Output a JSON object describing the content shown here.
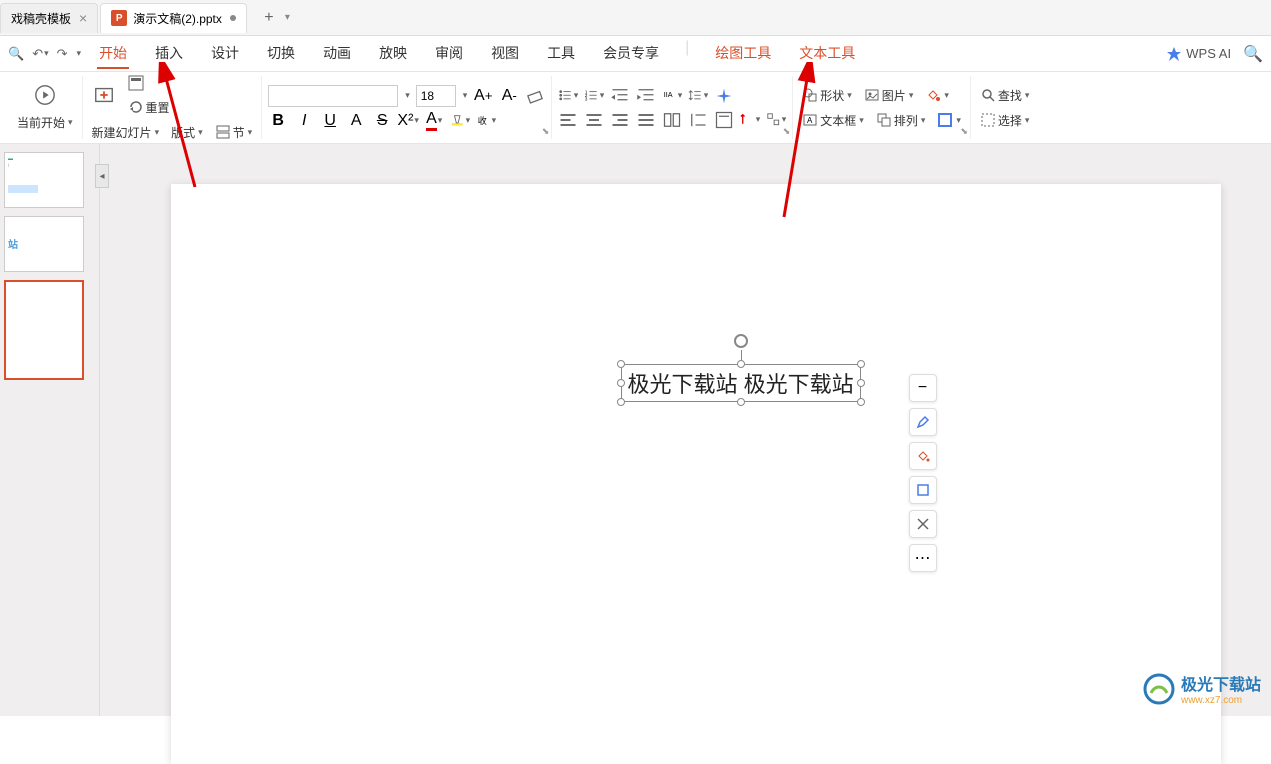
{
  "tabs": {
    "tab1": "戏稿壳模板",
    "tab2": "演示文稿(2).pptx"
  },
  "menu": {
    "start": "开始",
    "insert": "插入",
    "design": "设计",
    "transition": "切换",
    "animation": "动画",
    "slideshow": "放映",
    "review": "审阅",
    "view": "视图",
    "tools": "工具",
    "member": "会员专享",
    "drawing_tools": "绘图工具",
    "text_tools": "文本工具",
    "wps_ai": "WPS AI"
  },
  "ribbon": {
    "current_start": "当前开始",
    "new_slide": "新建幻灯片",
    "layout": "版式",
    "section": "节",
    "reset": "重置",
    "font_size": "18",
    "shape": "形状",
    "textbox": "文本框",
    "picture": "图片",
    "arrange": "排列",
    "find": "查找",
    "select": "选择"
  },
  "slide": {
    "textbox_content": "极光下载站 极光下载站",
    "thumb2_text": "站"
  },
  "watermark": {
    "title": "极光下载站",
    "url": "www.xz7.com"
  }
}
